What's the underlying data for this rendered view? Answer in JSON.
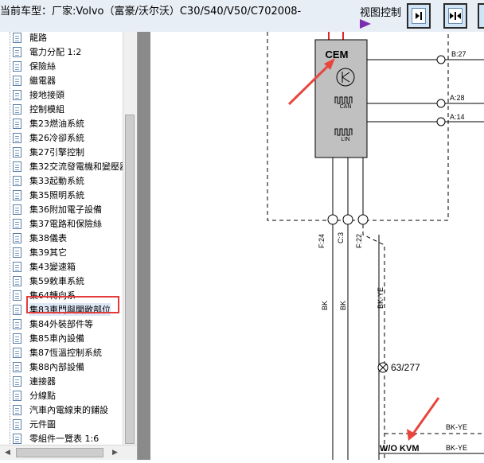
{
  "header": {
    "title": "当前车型：厂家:Volvo（富豪/沃尔沃）C30/S40/V50/C702008-",
    "view_control_label": "视图控制"
  },
  "tree": {
    "items": [
      "龍路",
      "電力分配 1:2",
      "保險絲",
      "繼電器",
      "接地接頭",
      "控制模組",
      "集23燃油系統",
      "集26冷卻系統",
      "集27引擎控制",
      "集32交流發電機和變壓器",
      "集33起動系統",
      "集35照明系統",
      "集36附加電子設備",
      "集37電路和保險絲",
      "集38儀表",
      "集39其它",
      "集43變速箱",
      "集59敕車系統",
      "集64轉向系",
      "集83車門與開敞部位",
      "集84外裝部件等",
      "集85車內設備",
      "集87恆溫控制系統",
      "集88內部設備",
      "連接器",
      "分線點",
      "汽車內電線束的鋪設",
      "元件圖",
      "零組件一覽表 1:6"
    ],
    "highlighted_index": 19
  },
  "diagram": {
    "module_label": "CEM",
    "can_label": "CAN",
    "lin_label": "LIN",
    "connectors": [
      "B:27",
      "A:28",
      "A:14"
    ],
    "pin_labels": [
      "F:24",
      "C:3",
      "F:22"
    ],
    "wire_colors": [
      "BK",
      "BK",
      "BK-YE"
    ],
    "ground_ref": "63/277",
    "right_wire_labels": [
      "BK-YE",
      "BK-YE"
    ],
    "variant_label": "W/O KVM",
    "colors": {
      "wire": "#e0262c",
      "arrow": "#e8463c",
      "box": "#c0c0c0"
    }
  }
}
